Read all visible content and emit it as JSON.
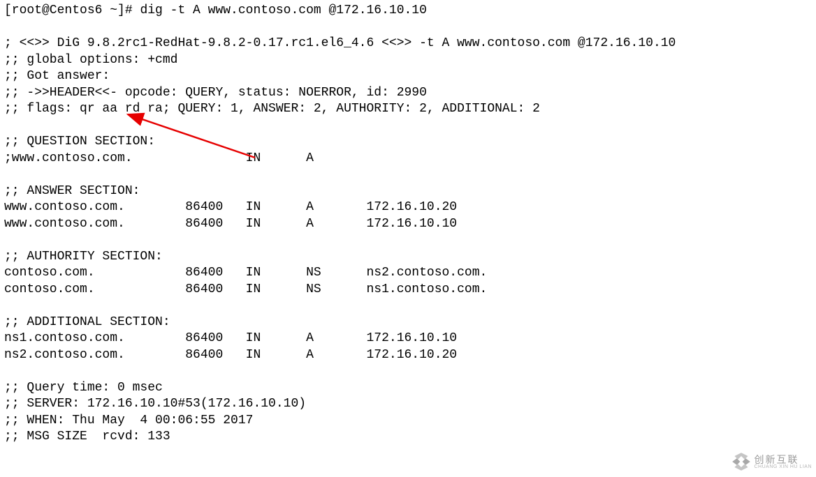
{
  "prompt": "[root@Centos6 ~]# ",
  "command": "dig -t A www.contoso.com @172.16.10.10",
  "header": {
    "banner": "; <<>> DiG 9.8.2rc1-RedHat-9.8.2-0.17.rc1.el6_4.6 <<>> -t A www.contoso.com @172.16.10.10",
    "global_options": ";; global options: +cmd",
    "got_answer": ";; Got answer:",
    "hdr_line": ";; ->>HEADER<<- opcode: QUERY, status: NOERROR, id: 2990",
    "flags_line": ";; flags: qr aa rd ra; QUERY: 1, ANSWER: 2, AUTHORITY: 2, ADDITIONAL: 2"
  },
  "question": {
    "title": ";; QUESTION SECTION:",
    "row": ";www.contoso.com.               IN      A"
  },
  "answer": {
    "title": ";; ANSWER SECTION:",
    "rows": [
      "www.contoso.com.        86400   IN      A       172.16.10.20",
      "www.contoso.com.        86400   IN      A       172.16.10.10"
    ]
  },
  "authority": {
    "title": ";; AUTHORITY SECTION:",
    "rows": [
      "contoso.com.            86400   IN      NS      ns2.contoso.com.",
      "contoso.com.            86400   IN      NS      ns1.contoso.com."
    ]
  },
  "additional": {
    "title": ";; ADDITIONAL SECTION:",
    "rows": [
      "ns1.contoso.com.        86400   IN      A       172.16.10.10",
      "ns2.contoso.com.        86400   IN      A       172.16.10.20"
    ]
  },
  "footer": {
    "query_time": ";; Query time: 0 msec",
    "server": ";; SERVER: 172.16.10.10#53(172.16.10.10)",
    "when": ";; WHEN: Thu May  4 00:06:55 2017",
    "msg_size": ";; MSG SIZE  rcvd: 133"
  },
  "watermark": {
    "cn": "创新互联",
    "py": "CHUANG XIN HU LIAN"
  }
}
